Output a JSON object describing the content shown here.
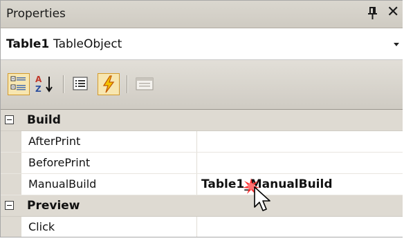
{
  "panel": {
    "title": "Properties"
  },
  "object_selector": {
    "name": "Table1",
    "type": "TableObject"
  },
  "toolbar": {
    "buttons": [
      {
        "icon": "categorized-icon",
        "active": true
      },
      {
        "icon": "alphabetical-sort-icon",
        "active": false
      },
      {
        "icon": "properties-icon",
        "active": false
      },
      {
        "icon": "events-icon",
        "active": true
      },
      {
        "icon": "property-pages-icon",
        "active": false
      }
    ]
  },
  "grid": {
    "categories": [
      {
        "label": "Build",
        "properties": [
          {
            "name": "AfterPrint",
            "value": ""
          },
          {
            "name": "BeforePrint",
            "value": ""
          },
          {
            "name": "ManualBuild",
            "value": "Table1_ManualBuild"
          }
        ]
      },
      {
        "label": "Preview",
        "properties": [
          {
            "name": "Click",
            "value": ""
          }
        ]
      }
    ]
  },
  "colors": {
    "category_bg": "#dedad2",
    "active_button_bg": "#f7e6b0",
    "active_button_border": "#d49a2a"
  }
}
